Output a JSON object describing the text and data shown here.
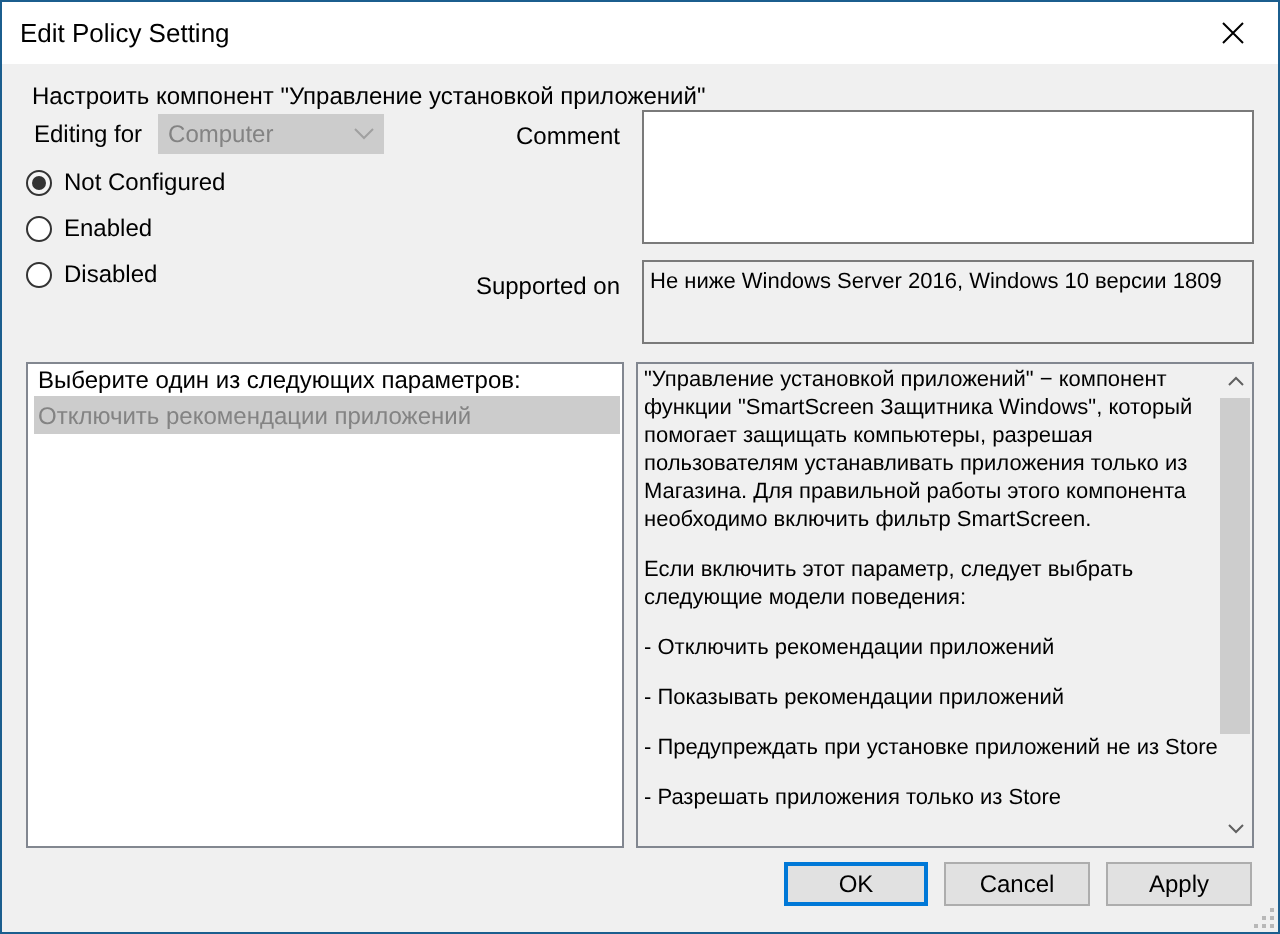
{
  "window": {
    "title": "Edit Policy Setting"
  },
  "heading": "Настроить компонент \"Управление установкой приложений\"",
  "editing_for": {
    "label": "Editing for",
    "value": "Computer",
    "disabled": true
  },
  "radios": [
    {
      "label": "Not Configured",
      "selected": true
    },
    {
      "label": "Enabled",
      "selected": false
    },
    {
      "label": "Disabled",
      "selected": false
    }
  ],
  "comment": {
    "label": "Comment"
  },
  "supported_on": {
    "label": "Supported on",
    "value": "Не ниже Windows Server 2016, Windows 10 версии 1809"
  },
  "options": {
    "header": "Выберите один из следующих параметров:",
    "items": [
      {
        "label": "Отключить рекомендации приложений",
        "disabled": true
      }
    ]
  },
  "help": {
    "paragraphs": [
      "\"Управление установкой приложений\" − компонент функции \"SmartScreen Защитника Windows\", который помогает защищать компьютеры, разрешая пользователям устанавливать приложения только из Магазина. Для правильной работы этого компонента необходимо включить фильтр SmartScreen.",
      "Если включить этот параметр, следует выбрать следующие модели поведения:",
      "- Отключить рекомендации приложений",
      "- Показывать рекомендации приложений",
      "- Предупреждать при установке приложений не из Store",
      "- Разрешать приложения только из Store"
    ]
  },
  "buttons": [
    {
      "label": "OK",
      "default": true
    },
    {
      "label": "Cancel",
      "default": false
    },
    {
      "label": "Apply",
      "default": false
    }
  ]
}
